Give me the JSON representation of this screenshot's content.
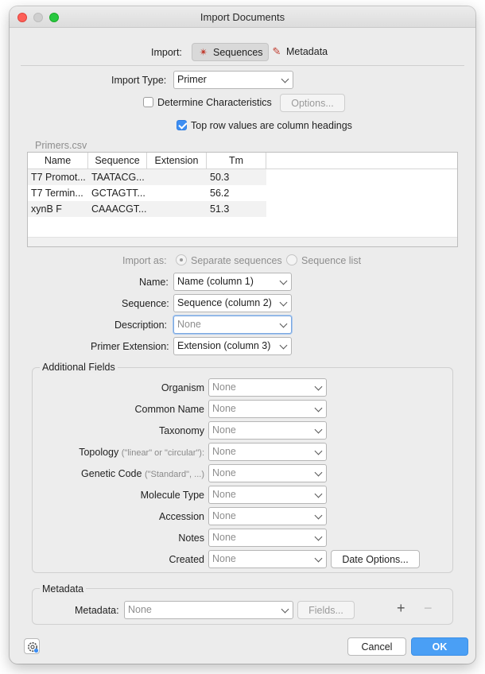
{
  "window": {
    "title": "Import Documents"
  },
  "import": {
    "label": "Import:",
    "tab_sequences": "Sequences",
    "tab_metadata": "Metadata"
  },
  "import_type": {
    "label": "Import Type:",
    "value": "Primer"
  },
  "determine": {
    "label": "Determine Characteristics",
    "checked": false,
    "options_button": "Options..."
  },
  "top_row": {
    "label": "Top row values are column headings",
    "checked": true
  },
  "file": {
    "name": "Primers.csv"
  },
  "table": {
    "columns": [
      "Name",
      "Sequence",
      "Extension",
      "Tm"
    ],
    "rows": [
      [
        "T7 Promot...",
        "TAATACG...",
        "",
        "50.3"
      ],
      [
        "T7 Termin...",
        "GCTAGTT...",
        "",
        "56.2"
      ],
      [
        "xynB F",
        "CAAACGT...",
        "",
        "51.3"
      ]
    ]
  },
  "import_as": {
    "label": "Import as:",
    "option_separate": "Separate sequences",
    "option_list": "Sequence list",
    "selected": "Separate sequences"
  },
  "mapping": {
    "name": {
      "label": "Name:",
      "value": "Name (column 1)"
    },
    "sequence": {
      "label": "Sequence:",
      "value": "Sequence (column 2)"
    },
    "description": {
      "label": "Description:",
      "value": "None"
    },
    "primer_extension": {
      "label": "Primer Extension:",
      "value": "Extension (column 3)"
    }
  },
  "additional": {
    "title": "Additional Fields",
    "fields": [
      {
        "label": "Organism",
        "hint": "",
        "value": "None"
      },
      {
        "label": "Common Name",
        "hint": "",
        "value": "None"
      },
      {
        "label": "Taxonomy",
        "hint": "",
        "value": "None"
      },
      {
        "label": "Topology",
        "hint": "(\"linear\" or \"circular\"):",
        "value": "None"
      },
      {
        "label": "Genetic Code",
        "hint": "(\"Standard\", ...)",
        "value": "None"
      },
      {
        "label": "Molecule Type",
        "hint": "",
        "value": "None"
      },
      {
        "label": "Accession",
        "hint": "",
        "value": "None"
      },
      {
        "label": "Notes",
        "hint": "",
        "value": "None"
      },
      {
        "label": "Created",
        "hint": "",
        "value": "None"
      }
    ],
    "date_options_button": "Date Options..."
  },
  "metadata": {
    "title": "Metadata",
    "label": "Metadata:",
    "value": "None",
    "fields_button": "Fields...",
    "add_symbol": "+",
    "remove_symbol": "−"
  },
  "footer": {
    "cancel": "Cancel",
    "ok": "OK"
  },
  "colors": {
    "accent": "#4a9ff5",
    "close": "#fe5f57",
    "max": "#28c840"
  }
}
